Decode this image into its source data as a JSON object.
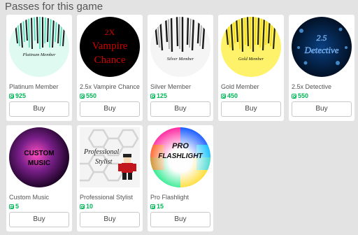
{
  "section": {
    "title": "Passes for this game"
  },
  "passes": [
    {
      "name": "Platinum Member",
      "price": "925",
      "buy_label": "Buy",
      "art_text": "Platinum Member",
      "colors": {
        "bg": "#dffaf0",
        "streak": "#2fc9a8",
        "text": "#111111"
      }
    },
    {
      "name": "2.5x Vampire Chance",
      "price": "550",
      "buy_label": "Buy",
      "art_text_lines": [
        "2X",
        "Vampire",
        "Chance"
      ],
      "colors": {
        "bg": "#000000",
        "text": "#d00000"
      }
    },
    {
      "name": "Silver Member",
      "price": "125",
      "buy_label": "Buy",
      "art_text": "Silver Member",
      "colors": {
        "bg": "#f5f5f5",
        "streak": "#1b1b1b",
        "text": "#111111"
      }
    },
    {
      "name": "Gold Member",
      "price": "450",
      "buy_label": "Buy",
      "art_text": "Gold Member",
      "colors": {
        "bg": "#fff26b",
        "streak": "#2a2a00",
        "text": "#111111"
      }
    },
    {
      "name": "2.5x Detective",
      "price": "550",
      "buy_label": "Buy",
      "art_text_lines": [
        "2.5",
        "Detective"
      ],
      "colors": {
        "bg": "#00112b",
        "text": "#2d8cff"
      }
    },
    {
      "name": "Custom Music",
      "price": "5",
      "buy_label": "Buy",
      "art_text_lines": [
        "CUSTOM",
        "MUSIC"
      ],
      "colors": {
        "bg": "#6b1a7a",
        "text": "#000000"
      }
    },
    {
      "name": "Professional Stylist",
      "price": "10",
      "buy_label": "Buy",
      "art_text_lines": [
        "Professional",
        "Stylist"
      ],
      "colors": {
        "bg": "#f4f4f4",
        "text": "#222222"
      }
    },
    {
      "name": "Pro Flashlight",
      "price": "15",
      "buy_label": "Buy",
      "art_text_lines": [
        "PRO",
        "FLASHLIGHT"
      ],
      "colors": {
        "bg": "#ff2aa0",
        "text": "#111111"
      }
    }
  ]
}
